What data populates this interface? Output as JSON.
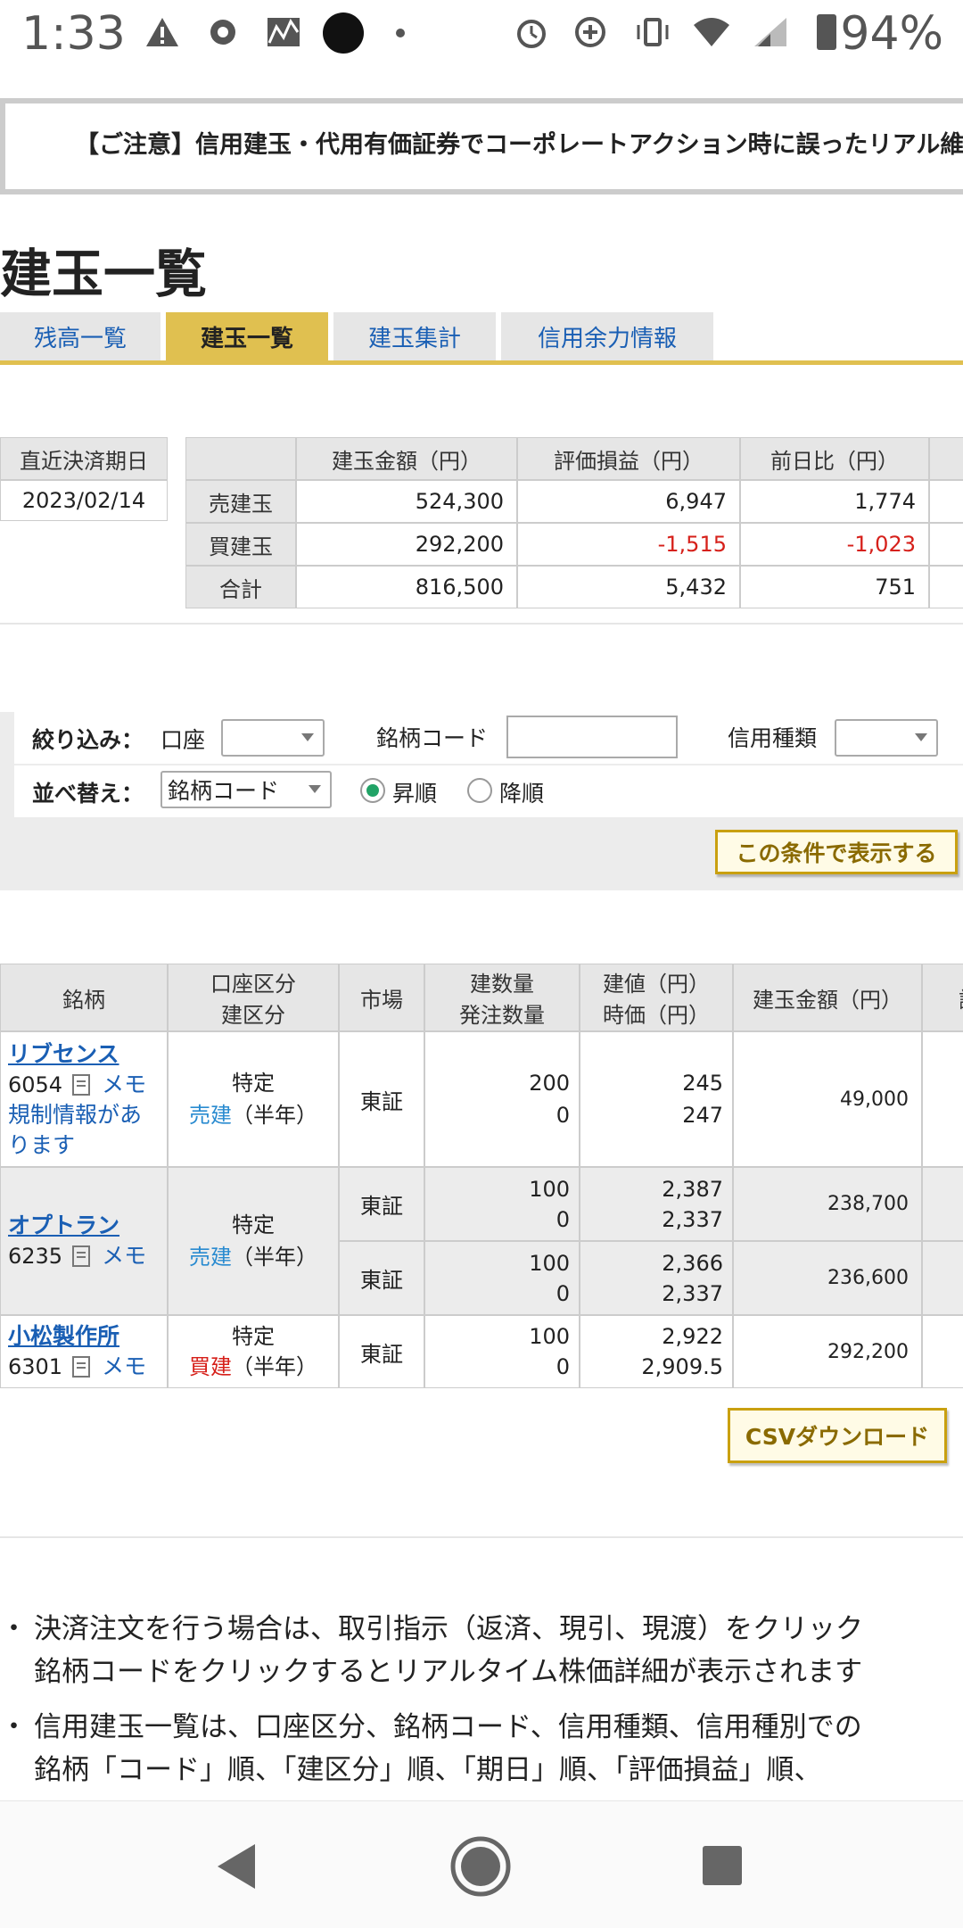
{
  "status_bar": {
    "time": "1:33",
    "battery": "94%"
  },
  "notice": {
    "text": "【ご注意】信用建玉・代用有価証券でコーポレートアクション時に誤ったリアル維持"
  },
  "page": {
    "title": "建玉一覧"
  },
  "tabs": [
    {
      "label": "残高一覧"
    },
    {
      "label": "建玉一覧"
    },
    {
      "label": "建玉集計"
    },
    {
      "label": "信用余力情報"
    }
  ],
  "settlement": {
    "label": "直近決済期日",
    "date": "2023/02/14"
  },
  "summary": {
    "headers": [
      "建玉金額（円）",
      "評価損益（円）",
      "前日比（円）"
    ],
    "rows": [
      {
        "label": "売建玉",
        "amount": "524,300",
        "pnl": "6,947",
        "change": "1,774"
      },
      {
        "label": "買建玉",
        "amount": "292,200",
        "pnl": "-1,515",
        "change": "-1,023"
      },
      {
        "label": "合計",
        "amount": "816,500",
        "pnl": "5,432",
        "change": "751"
      }
    ]
  },
  "filter": {
    "label": "絞り込み：",
    "account_label": "口座",
    "code_label": "銘柄コード",
    "credit_type_label": "信用種類",
    "sort_label": "並べ替え：",
    "sort_value": "銘柄コード",
    "asc_label": "昇順",
    "desc_label": "降順",
    "submit_label": "この条件で表示する"
  },
  "positions": {
    "headers": {
      "name": "銘柄",
      "account_line1": "口座区分",
      "account_line2": "建区分",
      "market": "市場",
      "qty_line1": "建数量",
      "qty_line2": "発注数量",
      "price_line1": "建値（円）",
      "price_line2": "時価（円）",
      "amount": "建玉金額（円）",
      "extra": "評"
    },
    "memo_label": "メモ",
    "rows": [
      {
        "name": "リブセンス",
        "code": "6054",
        "notice": "規制情報があ",
        "notice2": "ります",
        "account": "特定",
        "type": "売建",
        "term": "（半年）",
        "market": "東証",
        "qty": "200",
        "order_qty": "0",
        "price": "245",
        "current": "247",
        "amount": "49,000"
      },
      {
        "name": "オプトラン",
        "code": "6235",
        "account": "特定",
        "type": "売建",
        "term": "（半年）",
        "lots": [
          {
            "market": "東証",
            "qty": "100",
            "order_qty": "0",
            "price": "2,387",
            "current": "2,337",
            "amount": "238,700"
          },
          {
            "market": "東証",
            "qty": "100",
            "order_qty": "0",
            "price": "2,366",
            "current": "2,337",
            "amount": "236,600"
          }
        ]
      },
      {
        "name": "小松製作所",
        "code": "6301",
        "account": "特定",
        "type": "買建",
        "term": "（半年）",
        "market": "東証",
        "qty": "100",
        "order_qty": "0",
        "price": "2,922",
        "current": "2,909.5",
        "amount": "292,200"
      }
    ],
    "csv_label": "CSVダウンロード"
  },
  "notes": [
    "決済注文を行う場合は、取引指示（返済、現引、現渡）をクリック",
    "銘柄コードをクリックするとリアルタイム株価詳細が表示されます",
    "信用建玉一覧は、口座区分、銘柄コード、信用種類、信用種別での",
    "銘柄「コード」順、「建区分」順、「期日」順、「評価損益」順、"
  ],
  "bullet": "・",
  "colors": {
    "accent": "#e0c050",
    "link": "#1a5fb4",
    "negative": "#d6201a",
    "sell": "#2a8bd0"
  }
}
